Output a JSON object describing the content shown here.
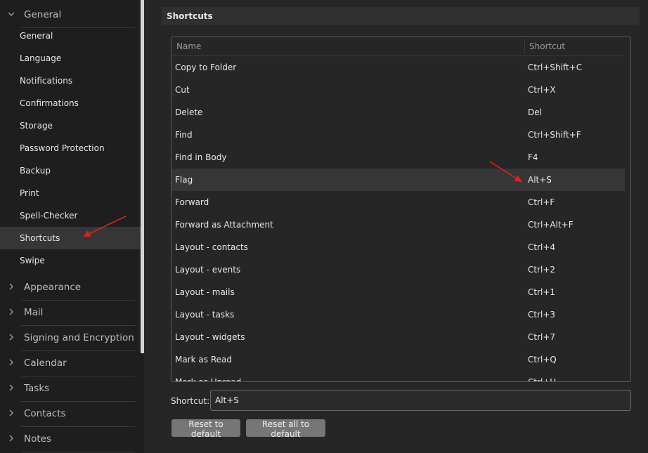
{
  "sidebar": {
    "groups": [
      {
        "label": "General",
        "expanded": true
      },
      {
        "label": "Appearance"
      },
      {
        "label": "Mail"
      },
      {
        "label": "Signing and Encryption"
      },
      {
        "label": "Calendar"
      },
      {
        "label": "Tasks"
      },
      {
        "label": "Contacts"
      },
      {
        "label": "Notes"
      }
    ],
    "general_items": [
      {
        "label": "General"
      },
      {
        "label": "Language"
      },
      {
        "label": "Notifications"
      },
      {
        "label": "Confirmations"
      },
      {
        "label": "Storage"
      },
      {
        "label": "Password Protection"
      },
      {
        "label": "Backup"
      },
      {
        "label": "Print"
      },
      {
        "label": "Spell-Checker"
      },
      {
        "label": "Shortcuts",
        "selected": true
      },
      {
        "label": "Swipe"
      }
    ]
  },
  "main": {
    "section_title": "Shortcuts",
    "table": {
      "headers": {
        "name": "Name",
        "shortcut": "Shortcut"
      },
      "rows": [
        {
          "name": "Copy to Folder",
          "shortcut": "Ctrl+Shift+C"
        },
        {
          "name": "Cut",
          "shortcut": "Ctrl+X"
        },
        {
          "name": "Delete",
          "shortcut": "Del"
        },
        {
          "name": "Find",
          "shortcut": "Ctrl+Shift+F"
        },
        {
          "name": "Find in Body",
          "shortcut": "F4"
        },
        {
          "name": "Flag",
          "shortcut": "Alt+S",
          "selected": true
        },
        {
          "name": "Forward",
          "shortcut": "Ctrl+F"
        },
        {
          "name": "Forward as Attachment",
          "shortcut": "Ctrl+Alt+F"
        },
        {
          "name": "Layout - contacts",
          "shortcut": "Ctrl+4"
        },
        {
          "name": "Layout - events",
          "shortcut": "Ctrl+2"
        },
        {
          "name": "Layout - mails",
          "shortcut": "Ctrl+1"
        },
        {
          "name": "Layout - tasks",
          "shortcut": "Ctrl+3"
        },
        {
          "name": "Layout - widgets",
          "shortcut": "Ctrl+7"
        },
        {
          "name": "Mark as Read",
          "shortcut": "Ctrl+Q"
        },
        {
          "name": "Mark as Unread",
          "shortcut": "Ctrl+U"
        }
      ]
    },
    "shortcut_label": "Shortcut:",
    "shortcut_value": "Alt+S",
    "buttons": {
      "reset": "Reset to default",
      "reset_all": "Reset all to default"
    }
  },
  "colors": {
    "background": "#262626",
    "sidebar": "#1e1e1e",
    "selection": "#363636",
    "button": "#767676",
    "annotation_arrow": "#e0201c"
  },
  "icons": {
    "expanded": "chevron-down-icon",
    "collapsed": "chevron-right-icon"
  }
}
